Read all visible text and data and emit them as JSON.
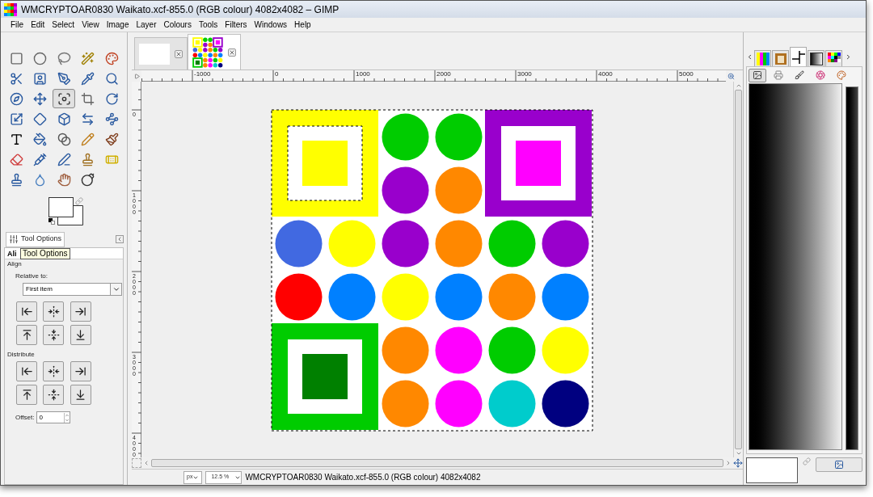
{
  "window": {
    "title": "WMCRYPTOAR0830 Waikato.xcf-855.0 (RGB colour) 4082x4082 – GIMP"
  },
  "menu": [
    "File",
    "Edit",
    "Select",
    "View",
    "Image",
    "Layer",
    "Colours",
    "Tools",
    "Filters",
    "Windows",
    "Help"
  ],
  "toolbox": {
    "tools": [
      {
        "selected": false
      },
      {
        "selected": false
      },
      {
        "selected": false
      },
      {
        "selected": false
      },
      {
        "selected": false
      },
      {
        "selected": false
      },
      {
        "selected": false
      },
      {
        "selected": false
      },
      {
        "selected": false
      },
      {
        "selected": false
      },
      {
        "selected": false
      },
      {
        "selected": false
      },
      {
        "selected": true
      },
      {
        "selected": false
      },
      {
        "selected": false
      },
      {
        "selected": false
      },
      {
        "selected": false
      },
      {
        "selected": false
      },
      {
        "selected": false
      },
      {
        "selected": false
      },
      {
        "selected": false
      },
      {
        "selected": false
      },
      {
        "selected": false
      },
      {
        "selected": false
      },
      {
        "selected": false
      },
      {
        "selected": false
      },
      {
        "selected": false
      },
      {
        "selected": false
      },
      {
        "selected": false
      },
      {
        "selected": false
      },
      {
        "selected": false
      },
      {
        "selected": false
      },
      {
        "selected": false
      },
      {
        "selected": false
      }
    ]
  },
  "tool_options": {
    "tab": "Tool Options",
    "tooltip": "Tool Options",
    "heading": "Ali",
    "section": "Align",
    "relative_label": "Relative to:",
    "relative_value": "First item",
    "distribute_label": "Distribute",
    "offset_label": "Offset:",
    "offset_value": "0"
  },
  "image_tabs": [
    {
      "kind": "blank",
      "selected": false
    },
    {
      "kind": "image",
      "selected": true
    }
  ],
  "rulers": {
    "horizontal": [
      "-1000",
      "0",
      "1000",
      "2000",
      "3000",
      "4000",
      "5000"
    ],
    "vertical": [
      "0",
      "1000",
      "2000",
      "3000",
      "4000"
    ]
  },
  "canvas": {
    "circles": [
      [
        {
          "kind": "square",
          "color": "#ffff00",
          "center": {
            "color": "#ffff00"
          },
          "layer_boundary": true
        },
        {
          "kind": "blank"
        },
        {
          "kind": "circle",
          "color": "#00cc00"
        },
        {
          "kind": "circle",
          "color": "#00cc00"
        },
        {
          "kind": "square",
          "color": "#9900cc",
          "center": {
            "color": "#ff00ff"
          },
          "layer_boundary": false
        },
        {
          "kind": "blank"
        }
      ],
      [
        {
          "kind": "blank"
        },
        {
          "kind": "blank"
        },
        {
          "kind": "circle",
          "color": "#9900cc"
        },
        {
          "kind": "circle",
          "color": "#ff8800"
        },
        {
          "kind": "blank"
        },
        {
          "kind": "blank"
        }
      ],
      [
        {
          "kind": "circle",
          "color": "#4169e1"
        },
        {
          "kind": "circle",
          "color": "#ffff00"
        },
        {
          "kind": "circle",
          "color": "#9900cc"
        },
        {
          "kind": "circle",
          "color": "#ff8800"
        },
        {
          "kind": "circle",
          "color": "#00cc00"
        },
        {
          "kind": "circle",
          "color": "#9900cc"
        }
      ],
      [
        {
          "kind": "circle",
          "color": "#ff0000"
        },
        {
          "kind": "circle",
          "color": "#0080ff"
        },
        {
          "kind": "circle",
          "color": "#ffff00"
        },
        {
          "kind": "circle",
          "color": "#0080ff"
        },
        {
          "kind": "circle",
          "color": "#ff8800"
        },
        {
          "kind": "circle",
          "color": "#0080ff"
        }
      ],
      [
        {
          "kind": "square",
          "color": "#00cc00",
          "center": {
            "color": "#008000"
          },
          "layer_boundary": false
        },
        {
          "kind": "blank"
        },
        {
          "kind": "circle",
          "color": "#ff8800"
        },
        {
          "kind": "circle",
          "color": "#ff00ff"
        },
        {
          "kind": "circle",
          "color": "#00cc00"
        },
        {
          "kind": "circle",
          "color": "#ffff00"
        }
      ],
      [
        {
          "kind": "blank"
        },
        {
          "kind": "blank"
        },
        {
          "kind": "circle",
          "color": "#ff8800"
        },
        {
          "kind": "circle",
          "color": "#ff00ff"
        },
        {
          "kind": "circle",
          "color": "#00cccc"
        },
        {
          "kind": "circle",
          "color": "#000080"
        }
      ]
    ]
  },
  "status": {
    "unit": "px",
    "zoom": "12.5 %",
    "text": "WMCRYPTOAR0830 Waikato.xcf-855.0 (RGB colour) 4082x4082"
  },
  "dock": {
    "top_tabs": [
      {
        "selected": false
      },
      {
        "selected": false
      },
      {
        "selected": true
      },
      {
        "selected": false
      },
      {
        "selected": false
      }
    ],
    "tabs": [
      {
        "selected": true
      },
      {
        "selected": false
      },
      {
        "selected": false
      },
      {
        "selected": false
      },
      {
        "selected": false
      }
    ]
  }
}
